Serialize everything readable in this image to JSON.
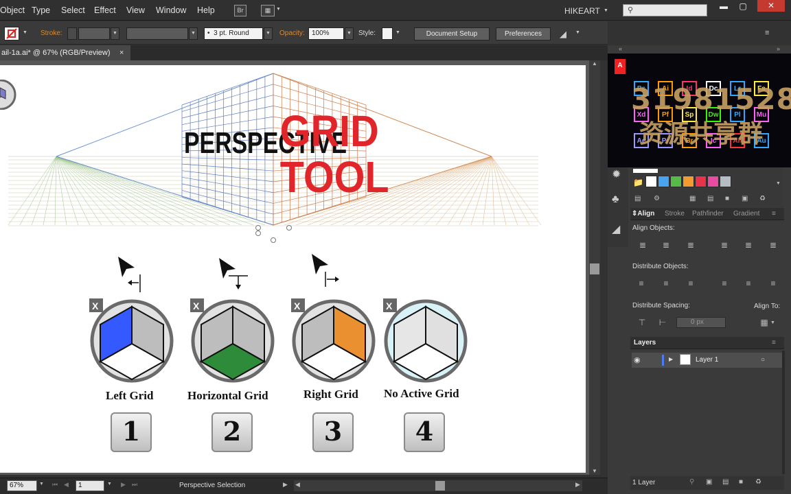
{
  "menu": {
    "items": [
      "Object",
      "Type",
      "Select",
      "Effect",
      "View",
      "Window",
      "Help"
    ],
    "bridge": "Br",
    "workspace": "HIKEART",
    "win_minimize": "▬",
    "win_restore": "▢",
    "win_close": "✕"
  },
  "control": {
    "stroke_label": "Stroke:",
    "brush": "3 pt. Round",
    "opacity_label": "Opacity:",
    "opacity": "100%",
    "style_label": "Style:",
    "document_setup": "Document Setup",
    "preferences": "Preferences"
  },
  "document": {
    "tab_title": "ail-1a.ai* @ 67% (RGB/Preview)",
    "close": "×"
  },
  "artwork": {
    "title_1": "PERSPECTIVE",
    "title_2": "GRID",
    "title_3": "TOOL",
    "mode_close": "X",
    "labels": [
      "Left Grid",
      "Horizontal Grid",
      "Right Grid",
      "No Active Grid"
    ],
    "keys": [
      "1",
      "2",
      "3",
      "4"
    ],
    "colors": {
      "left": "#3459ff",
      "horizontal": "#2e8b3a",
      "right": "#ea9030",
      "none_bg": "#d8f2f7",
      "grid_red": "#e0262b"
    }
  },
  "status": {
    "zoom": "67%",
    "page": "1",
    "tool": "Perspective Selection"
  },
  "promo": {
    "apps": [
      {
        "t": "Ps",
        "c": "#31a8ff"
      },
      {
        "t": "Ai",
        "c": "#ff9a00"
      },
      {
        "t": "Id",
        "c": "#ff3366"
      },
      {
        "t": "Dc",
        "c": "#ffffff"
      },
      {
        "t": "Lr",
        "c": "#31a8ff"
      },
      {
        "t": "Fs",
        "c": "#ffeb3b"
      },
      {
        "t": "Xd",
        "c": "#ff61f6"
      },
      {
        "t": "Pf",
        "c": "#ff9a00"
      },
      {
        "t": "Sp",
        "c": "#ffeb3b"
      },
      {
        "t": "Dw",
        "c": "#35fa00"
      },
      {
        "t": "Pl",
        "c": "#31a8ff"
      },
      {
        "t": "Mu",
        "c": "#ff61f6"
      },
      {
        "t": "Ae",
        "c": "#9999ff"
      },
      {
        "t": "Pr",
        "c": "#9999ff"
      },
      {
        "t": "Br",
        "c": "#ff9a00"
      },
      {
        "t": "Ic",
        "c": "#ff61f6"
      },
      {
        "t": "An",
        "c": "#ff3333"
      },
      {
        "t": "Au",
        "c": "#31a8ff"
      }
    ],
    "number": "319815288",
    "text": "资源共享群"
  },
  "align": {
    "tabs": [
      "Align",
      "Stroke",
      "Pathfinder",
      "Gradient"
    ],
    "objects": "Align Objects:",
    "distribute": "Distribute Objects:",
    "spacing": "Distribute Spacing:",
    "align_to": "Align To:",
    "spacing_value": "0 px"
  },
  "layers": {
    "tab": "Layers",
    "layer_name": "Layer 1",
    "count": "1 Layer"
  },
  "swatches": [
    "#ffffff",
    "#4aa3f0",
    "#57b947",
    "#f29b30",
    "#e8334a",
    "#e84ca0",
    "#b5bcc3"
  ]
}
